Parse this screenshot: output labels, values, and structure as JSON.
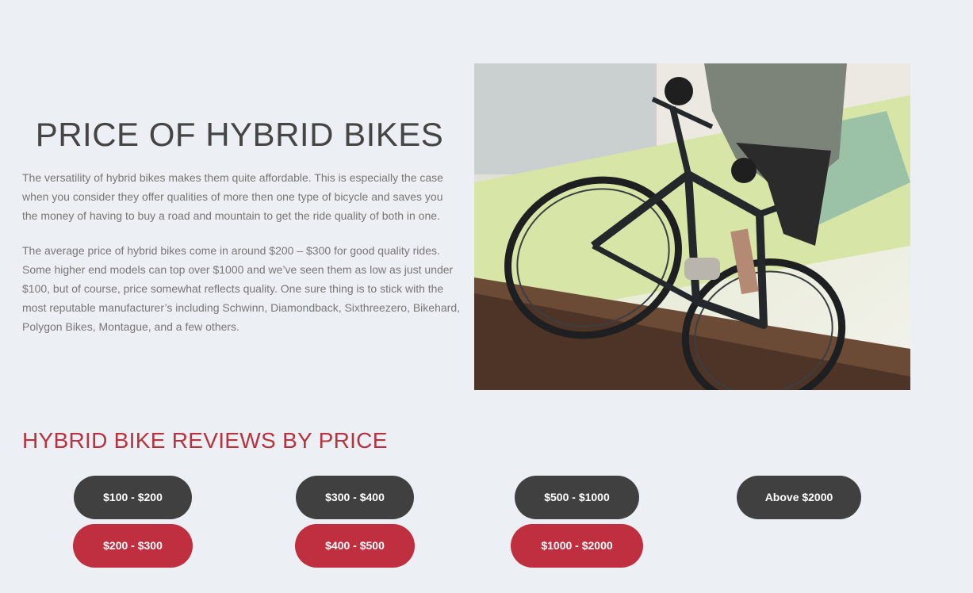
{
  "price_section": {
    "title": "PRICE OF HYBRID BIKES",
    "paragraph_1": "The versatility of hybrid bikes makes them quite affordable. This is especially the case when you consider they offer qualities of more then one type of bicycle and saves you the money of having to buy a road and mountain to get the ride quality of both in one.",
    "paragraph_2": "The average price of hybrid bikes come in around $200 – $300 for good quality rides. Some higher end models can top over $1000 and we’ve seen them as low as just under $100, but of course, price somewhat reflects quality. One sure thing is to stick with the most reputable manufacturer’s including Schwinn, Diamondback, Sixthreezero, Bikehard, Polygon Bikes, Montague, and a few others."
  },
  "reviews_section": {
    "heading": "HYBRID BIKE REVIEWS BY PRICE",
    "buttons": [
      {
        "label": "$100 - $200",
        "style": "dark"
      },
      {
        "label": "$300 - $400",
        "style": "dark"
      },
      {
        "label": "$500 - $1000",
        "style": "dark"
      },
      {
        "label": "Above $2000",
        "style": "dark"
      },
      {
        "label": "$200 - $300",
        "style": "red"
      },
      {
        "label": "$400 - $500",
        "style": "red"
      },
      {
        "label": "$1000 - $2000",
        "style": "red"
      }
    ]
  },
  "colors": {
    "background": "#eceff3",
    "button_dark": "#404040",
    "button_red": "#bf2f3f",
    "heading_red": "#b63340"
  }
}
